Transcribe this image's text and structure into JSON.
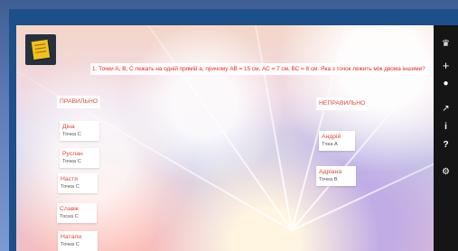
{
  "question": {
    "number": "1.",
    "text": "Точки А, В, С лежать на одній прямій а, причому АВ = 15 см, АС = 7 см, ВС = 8 см. Яка з точок лежить між двома іншими?"
  },
  "columns": {
    "correct_label": "ПРАВИЛЬНО",
    "incorrect_label": "НЕПРАВИЛЬНО"
  },
  "correct_cards": [
    {
      "name": "Діна",
      "answer": "Точка С"
    },
    {
      "name": "Руслан",
      "answer": "Точка С"
    },
    {
      "name": "Настя",
      "answer": "Точка С"
    },
    {
      "name": "Славік",
      "answer": "Тоска С"
    },
    {
      "name": "Натали",
      "answer": "Точка С"
    }
  ],
  "incorrect_cards": [
    {
      "name": "Андрій",
      "answer": "Тчка А"
    },
    {
      "name": "Адріана",
      "answer": "Точка В"
    }
  ],
  "toolbar": {
    "icons": [
      "crown-icon",
      "plus-icon",
      "user-icon",
      "share-icon",
      "info-icon",
      "help-icon",
      "gear-icon"
    ],
    "glyphs": [
      "♛",
      "+",
      "●",
      "↗",
      "i",
      "?",
      "⚙"
    ]
  },
  "colors": {
    "accent": "#e0473a",
    "question_text": "#e02a2a",
    "sidebar": "#151515",
    "logo_note": "#f2c11d"
  }
}
